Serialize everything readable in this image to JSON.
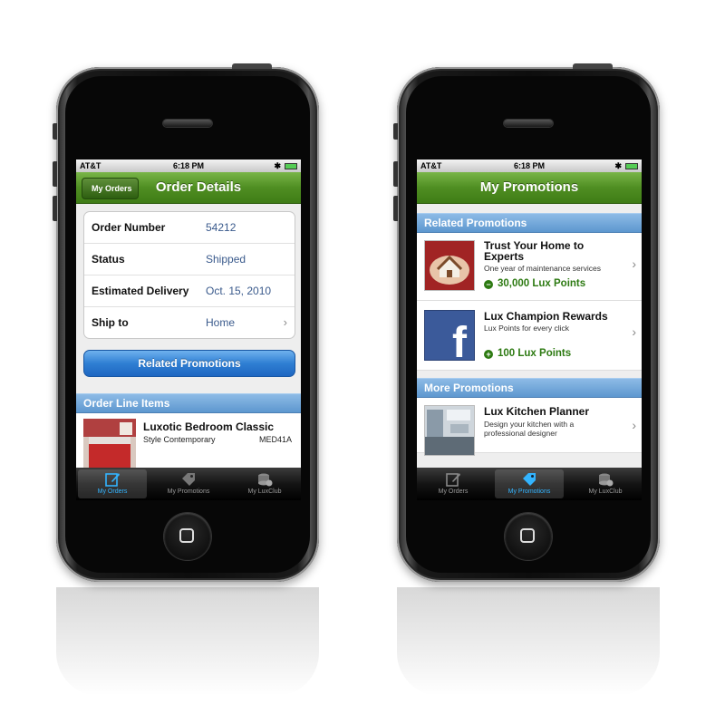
{
  "left_phone": {
    "status": {
      "carrier": "AT&T",
      "time": "6:18 PM"
    },
    "navbar": {
      "back_label": "My Orders",
      "title": "Order Details"
    },
    "details": [
      {
        "label": "Order Number",
        "value": "54212"
      },
      {
        "label": "Status",
        "value": "Shipped"
      },
      {
        "label": "Estimated Delivery",
        "value": "Oct. 15, 2010"
      },
      {
        "label": "Ship to",
        "value": "Home"
      }
    ],
    "related_button": "Related Promotions",
    "section_title": "Order Line Items",
    "line_item": {
      "name": "Luxotic Bedroom Classic",
      "style": "Style Contemporary",
      "sku": "MED41A"
    },
    "tabs": [
      "My Orders",
      "My Promotions",
      "My LuxClub"
    ],
    "active_tab": 0
  },
  "right_phone": {
    "status": {
      "carrier": "AT&T",
      "time": "6:18 PM"
    },
    "navbar": {
      "title": "My Promotions"
    },
    "related_section": "Related Promotions",
    "related": [
      {
        "title": "Trust Your Home to Experts",
        "subtitle": "One year of maintenance services",
        "points": "30,000 Lux Points",
        "icon": "house-hands-icon"
      },
      {
        "title": "Lux Champion Rewards",
        "subtitle": "Lux Points for every click",
        "points": "100 Lux Points",
        "icon": "facebook-icon"
      }
    ],
    "more_section": "More Promotions",
    "more": [
      {
        "title": "Lux Kitchen Planner",
        "subtitle": "Design your kitchen with a professional designer"
      }
    ],
    "tabs": [
      "My Orders",
      "My Promotions",
      "My LuxClub"
    ],
    "active_tab": 1
  },
  "colors": {
    "nav_green": "#4f8e22",
    "section_blue": "#5d97cf",
    "button_blue": "#2f7fd3",
    "tab_active": "#33b4ff",
    "points_green": "#2d7a12"
  }
}
